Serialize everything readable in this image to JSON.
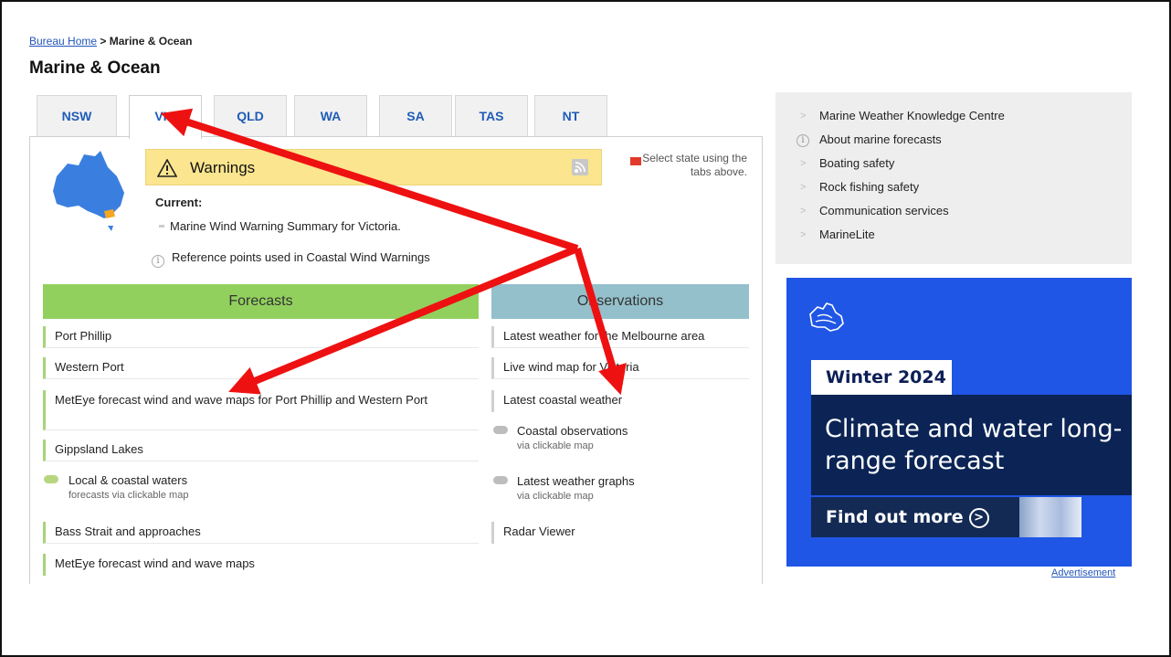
{
  "breadcrumb": {
    "home": "Bureau Home",
    "separator": ">",
    "current": "Marine & Ocean"
  },
  "page_title": "Marine & Ocean",
  "tabs": [
    "NSW",
    "VIC",
    "QLD",
    "WA",
    "SA",
    "TAS",
    "NT"
  ],
  "active_tab": "VIC",
  "warnings": {
    "title": "Warnings",
    "current_label": "Current:",
    "current_item": "Marine Wind Warning Summary for Victoria.",
    "reference": "Reference points used in Coastal Wind Warnings",
    "select_hint": "Select state using the tabs above.",
    "rss_icon": "rss-icon",
    "warning_icon": "warning-triangle-icon"
  },
  "forecasts": {
    "heading": "Forecasts",
    "items": [
      "Port Phillip",
      "Western Port",
      "MetEye forecast wind and wave maps for Port Phillip and Western Port",
      "Gippsland Lakes"
    ],
    "local_waters": {
      "title": "Local & coastal waters",
      "sub": "forecasts via clickable map"
    },
    "more_items": [
      "Bass Strait and approaches",
      "MetEye forecast wind and wave maps"
    ]
  },
  "observations": {
    "heading": "Observations",
    "items": [
      "Latest weather for the Melbourne area",
      "Live wind map for Victoria",
      "Latest coastal weather"
    ],
    "coastal": {
      "title": "Coastal observations",
      "sub": "via clickable map"
    },
    "graphs": {
      "title": "Latest weather graphs",
      "sub": "via clickable map"
    },
    "radar": "Radar Viewer"
  },
  "sidebar": {
    "links": [
      "Marine Weather Knowledge Centre",
      "About marine forecasts",
      "Boating safety",
      "Rock fishing safety",
      "Communication services",
      "MarineLite"
    ]
  },
  "ad": {
    "label": "Winter 2024",
    "headline": "Climate and water long-range forecast",
    "cta": "Find out more",
    "footnote": "Advertisement"
  },
  "colors": {
    "forecasts_head": "#92d05e",
    "observations_head": "#94c0cb",
    "warnings_bg": "#fbe58e",
    "ad_bg": "#1f56e6",
    "annotation_arrow": "#ee1111"
  }
}
